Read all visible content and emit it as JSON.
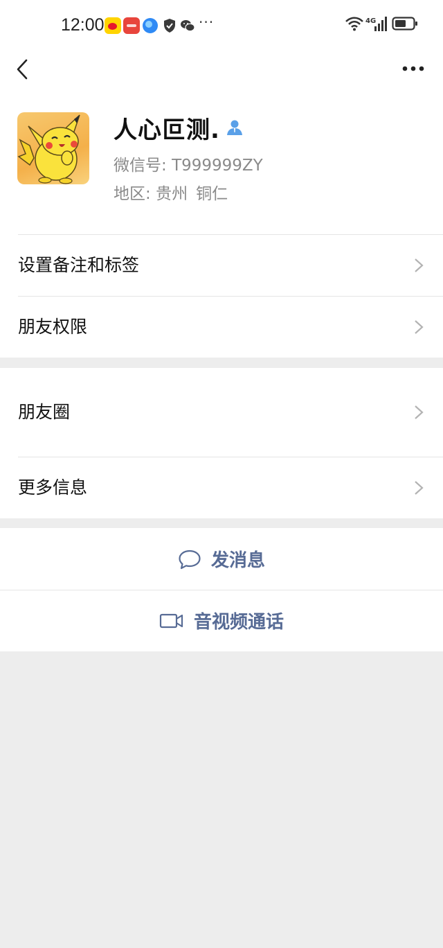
{
  "status_bar": {
    "time": "12:00",
    "dots": "···",
    "network": "4G"
  },
  "nav": {
    "back_icon": "chevron-left-icon",
    "more_icon": "more-horizontal-icon"
  },
  "profile": {
    "nickname": "人心叵测.",
    "wechat_id_label": "微信号:",
    "wechat_id_value": "T999999ZY",
    "region_label": "地区:",
    "region_province": "贵州",
    "region_city": "铜仁",
    "gender_icon": "person-icon"
  },
  "settings_group": {
    "remark_label": "设置备注和标签",
    "permission_label": "朋友权限"
  },
  "moments_group": {
    "moments_label": "朋友圈",
    "more_info_label": "更多信息"
  },
  "actions": {
    "send_message": "发消息",
    "av_call": "音视频通话"
  },
  "colors": {
    "link_blue": "#576b95",
    "background": "#ededed",
    "gender_icon": "#5aa0e8"
  }
}
